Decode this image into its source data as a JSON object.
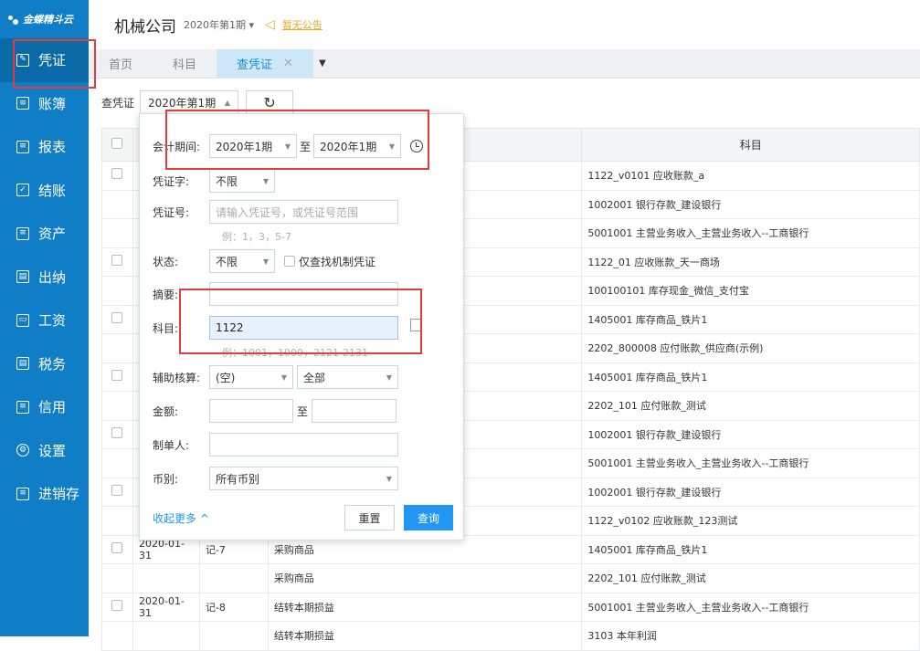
{
  "sidebar": {
    "logo": "金蝶精斗云",
    "items": [
      {
        "label": "凭证",
        "icon": "voucher-icon"
      },
      {
        "label": "账簿",
        "icon": "book-icon"
      },
      {
        "label": "报表",
        "icon": "report-icon"
      },
      {
        "label": "结账",
        "icon": "check-icon"
      },
      {
        "label": "资产",
        "icon": "asset-icon"
      },
      {
        "label": "出纳",
        "icon": "cashier-icon"
      },
      {
        "label": "工资",
        "icon": "salary-icon"
      },
      {
        "label": "税务",
        "icon": "tax-icon"
      },
      {
        "label": "信用",
        "icon": "credit-icon"
      },
      {
        "label": "设置",
        "icon": "gear-icon"
      },
      {
        "label": "进销存",
        "icon": "inventory-icon"
      }
    ]
  },
  "header": {
    "company": "机械公司",
    "period": "2020年第1期",
    "announcement": "暂无公告"
  },
  "tabs": [
    {
      "label": "首页"
    },
    {
      "label": "科目"
    },
    {
      "label": "查凭证"
    }
  ],
  "toolbar": {
    "label": "查凭证",
    "period_value": "2020年第1期"
  },
  "table": {
    "headers": [
      "科目"
    ],
    "rows": [
      {
        "date": "",
        "no": "",
        "summary": "",
        "subject": "1122_v0101 应收账款_a"
      },
      {
        "date": "",
        "no": "",
        "summary": "",
        "subject": "1002001 银行存款_建设银行"
      },
      {
        "date": "",
        "no": "",
        "summary": "",
        "subject": "5001001 主营业务收入_主营业务收入--工商银行"
      },
      {
        "date": "",
        "no": "",
        "summary": "",
        "subject": "1122_01 应收账款_天一商场"
      },
      {
        "date": "",
        "no": "",
        "summary": "",
        "subject": "100100101 库存现金_微信_支付宝"
      },
      {
        "date": "",
        "no": "",
        "summary": "",
        "subject": "1405001 库存商品_铁片1"
      },
      {
        "date": "",
        "no": "",
        "summary": "",
        "subject": "2202_800008 应付账款_供应商(示例)"
      },
      {
        "date": "",
        "no": "",
        "summary": "",
        "subject": "1405001 库存商品_铁片1"
      },
      {
        "date": "",
        "no": "",
        "summary": "",
        "subject": "2202_101 应付账款_测试"
      },
      {
        "date": "",
        "no": "",
        "summary": "",
        "subject": "1002001 银行存款_建设银行"
      },
      {
        "date": "",
        "no": "",
        "summary": "",
        "subject": "5001001 主营业务收入_主营业务收入--工商银行"
      },
      {
        "date": "",
        "no": "",
        "summary": "",
        "subject": "1002001 银行存款_建设银行"
      },
      {
        "date": "",
        "no": "",
        "summary": "",
        "subject": "1122_v0102 应收账款_123测试"
      },
      {
        "date": "2020-01-31",
        "no": "记-7",
        "summary": "采购商品",
        "subject": "1405001 库存商品_铁片1"
      },
      {
        "date": "",
        "no": "",
        "summary": "采购商品",
        "subject": "2202_101 应付账款_测试"
      },
      {
        "date": "2020-01-31",
        "no": "记-8",
        "summary": "结转本期损益",
        "subject": "5001001 主营业务收入_主营业务收入--工商银行"
      },
      {
        "date": "",
        "no": "",
        "summary": "结转本期损益",
        "subject": "3103 本年利润"
      }
    ]
  },
  "filter": {
    "period_label": "会计期间:",
    "period_from": "2020年1期",
    "to": "至",
    "period_to": "2020年1期",
    "word_label": "凭证字:",
    "word_value": "不限",
    "no_label": "凭证号:",
    "no_placeholder": "请输入凭证号，或凭证号范围",
    "no_hint": "例：1，3，5-7",
    "status_label": "状态:",
    "status_value": "不限",
    "machine_only": "仅查找机制凭证",
    "summary_label": "摘要:",
    "summary_value": "",
    "subject_label": "科目:",
    "subject_value": "1122",
    "subject_hint": "例：1001，1009，2121-2131",
    "aux_label": "辅助核算:",
    "aux_type": "(空)",
    "aux_value": "全部",
    "amount_label": "金额:",
    "amount_to": "至",
    "creator_label": "制单人:",
    "currency_label": "币别:",
    "currency_value": "所有币别",
    "collapse": "收起更多",
    "reset": "重置",
    "query": "查询"
  }
}
